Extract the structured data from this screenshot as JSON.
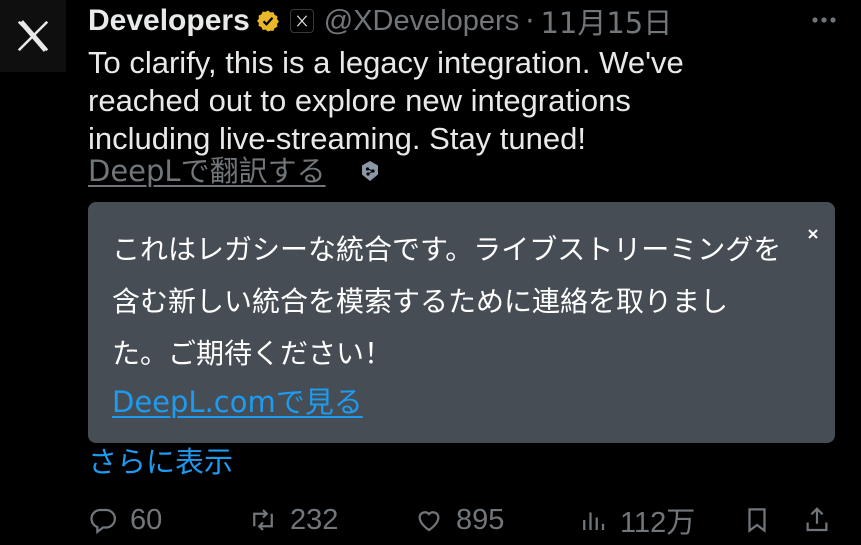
{
  "author": {
    "display_name": "Developers",
    "handle": "@XDevelopers",
    "date": "11月15日",
    "avatar_icon": "x-logo-icon",
    "verified_badge_color": "#e8b829"
  },
  "tweet": {
    "text": "To clarify, this is a legacy integration. We've\nreached out to explore new integrations\nincluding live-streaming. Stay tuned!",
    "translate_link": "DeepLで翻訳する"
  },
  "translation_popup": {
    "text": "これはレガシーな統合です。ライブストリーミングを\n含む新しい統合を模索するために連絡を取りまし\nた。ご期待ください！",
    "link": "DeepL.comで見る",
    "close_label": "×",
    "background": "#474d54"
  },
  "show_more": "さらに表示",
  "actions": {
    "reply_count": "60",
    "retweet_count": "232",
    "like_count": "895",
    "views_count": "112万"
  },
  "colors": {
    "background": "#000000",
    "text_primary": "#e7e9ea",
    "text_secondary": "#71767b",
    "link": "#1d9bf0"
  }
}
